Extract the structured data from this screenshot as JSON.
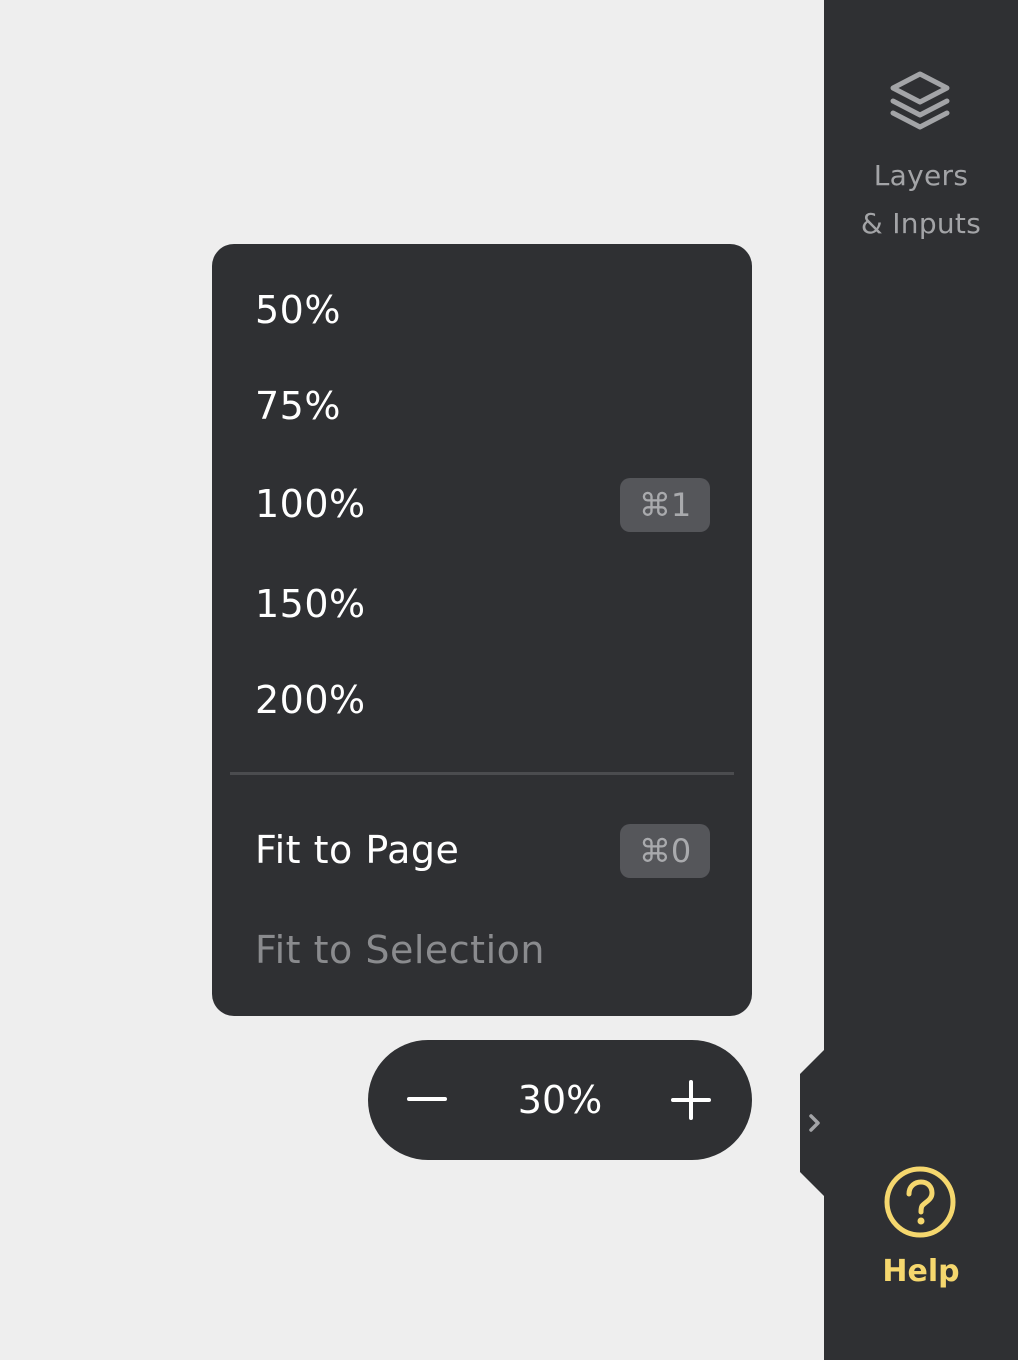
{
  "sidebar": {
    "layers": {
      "icon": "layers-icon",
      "label_line1": "Layers",
      "label_line2": "& Inputs"
    },
    "help": {
      "icon": "help-circle-icon",
      "label": "Help",
      "color": "#f5d76e"
    },
    "collapse_icon": "chevron-right-icon"
  },
  "zoom_menu": {
    "items": [
      {
        "label": "50%"
      },
      {
        "label": "75%"
      },
      {
        "label": "100%",
        "shortcut": "⌘1"
      },
      {
        "label": "150%"
      },
      {
        "label": "200%"
      }
    ],
    "fit_items": [
      {
        "label": "Fit to Page",
        "shortcut": "⌘0",
        "enabled": true
      },
      {
        "label": "Fit to Selection",
        "enabled": false
      }
    ]
  },
  "zoom_control": {
    "value": "30%",
    "minus_icon": "minus-icon",
    "plus_icon": "plus-icon"
  },
  "colors": {
    "panel_bg": "#2f3033",
    "canvas_bg": "#eeeeee",
    "text_primary": "#ffffff",
    "text_muted": "#8a8b8e",
    "shortcut_bg": "#55565a",
    "accent": "#f5d76e"
  }
}
